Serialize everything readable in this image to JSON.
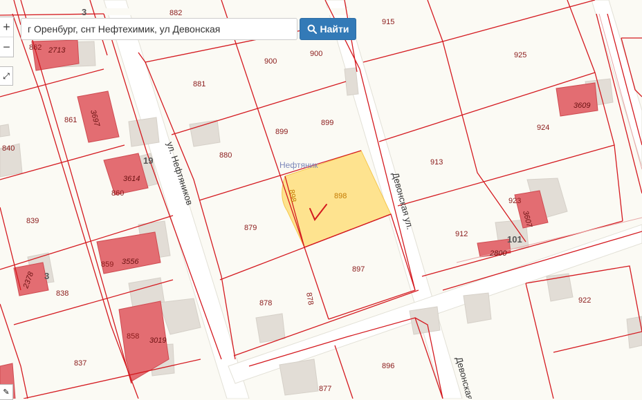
{
  "search": {
    "value": "г Оренбург, снт Нефтехимик, ул Девонская",
    "placeholder": ""
  },
  "find_button": {
    "label": "Найти",
    "icon": "search-icon"
  },
  "zoom": {
    "in": "+",
    "out": "−"
  },
  "colors": {
    "parcel_border": "#d4191f",
    "building": "#e36d72",
    "highlight": "#ffe28a",
    "road": "#ffffff",
    "background": "#fbfaf4"
  },
  "parcels": [
    {
      "label": "882"
    },
    {
      "label": "915"
    },
    {
      "label": "900"
    },
    {
      "label": "900"
    },
    {
      "label": "925"
    },
    {
      "label": "881"
    },
    {
      "label": "862"
    },
    {
      "label": "861"
    },
    {
      "label": "840"
    },
    {
      "label": "899"
    },
    {
      "label": "899"
    },
    {
      "label": "924"
    },
    {
      "label": "880"
    },
    {
      "label": "913"
    },
    {
      "label": "898"
    },
    {
      "label": "898"
    },
    {
      "label": "860"
    },
    {
      "label": "839"
    },
    {
      "label": "879"
    },
    {
      "label": "912"
    },
    {
      "label": "923"
    },
    {
      "label": "859"
    },
    {
      "label": "897"
    },
    {
      "label": "838"
    },
    {
      "label": "878"
    },
    {
      "label": "878"
    },
    {
      "label": "922"
    },
    {
      "label": "858"
    },
    {
      "label": "837"
    },
    {
      "label": "896"
    },
    {
      "label": "877"
    },
    {
      "label": "3"
    },
    {
      "label": "101"
    },
    {
      "label": "19"
    },
    {
      "label": "3"
    }
  ],
  "buildings": [
    {
      "label": "2713"
    },
    {
      "label": "3697"
    },
    {
      "label": "3614"
    },
    {
      "label": "3556"
    },
    {
      "label": "2378"
    },
    {
      "label": "3019"
    },
    {
      "label": "3609"
    },
    {
      "label": "3607"
    },
    {
      "label": "2800"
    }
  ],
  "streets": [
    {
      "label": "ул. Нефтяников"
    },
    {
      "label": "Девонская ул."
    },
    {
      "label": "Девонская"
    }
  ],
  "poi": {
    "label": "Нефтяник"
  },
  "selected_parcel": "898"
}
